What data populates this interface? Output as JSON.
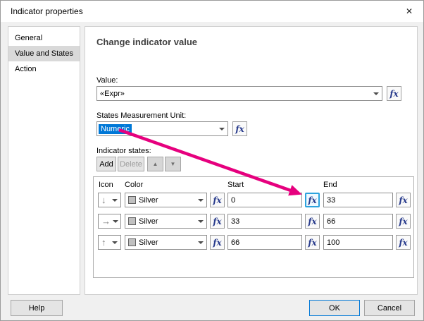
{
  "dialog": {
    "title": "Indicator properties",
    "close_glyph": "✕"
  },
  "sidebar": {
    "items": [
      {
        "label": "General"
      },
      {
        "label": "Value and States"
      },
      {
        "label": "Action"
      }
    ]
  },
  "main": {
    "heading": "Change indicator value",
    "value_label": "Value:",
    "value_text": "«Expr»",
    "unit_label": "States Measurement Unit:",
    "unit_value": "Numeric",
    "states_label": "Indicator states:",
    "toolbar": {
      "add_label": "Add",
      "delete_label": "Delete",
      "up_glyph": "▲",
      "down_glyph": "▼"
    },
    "states_table": {
      "headers": [
        "Icon",
        "Color",
        "Start",
        "End"
      ],
      "rows": [
        {
          "icon": "down-arrow",
          "icon_glyph": "↓",
          "color": "Silver",
          "start": "0",
          "end": "33"
        },
        {
          "icon": "right-arrow",
          "icon_glyph": "→",
          "color": "Silver",
          "start": "33",
          "end": "66"
        },
        {
          "icon": "up-arrow",
          "icon_glyph": "↑",
          "color": "Silver",
          "start": "66",
          "end": "100"
        }
      ]
    }
  },
  "footer": {
    "help_label": "Help",
    "ok_label": "OK",
    "cancel_label": "Cancel"
  },
  "fx_label": "fx",
  "colors": {
    "selection_blue": "#0078d7",
    "annotation_magenta": "#e6007e",
    "fx_highlight_blue": "#2da3dd",
    "swatch_silver": "#c0c0c0"
  }
}
